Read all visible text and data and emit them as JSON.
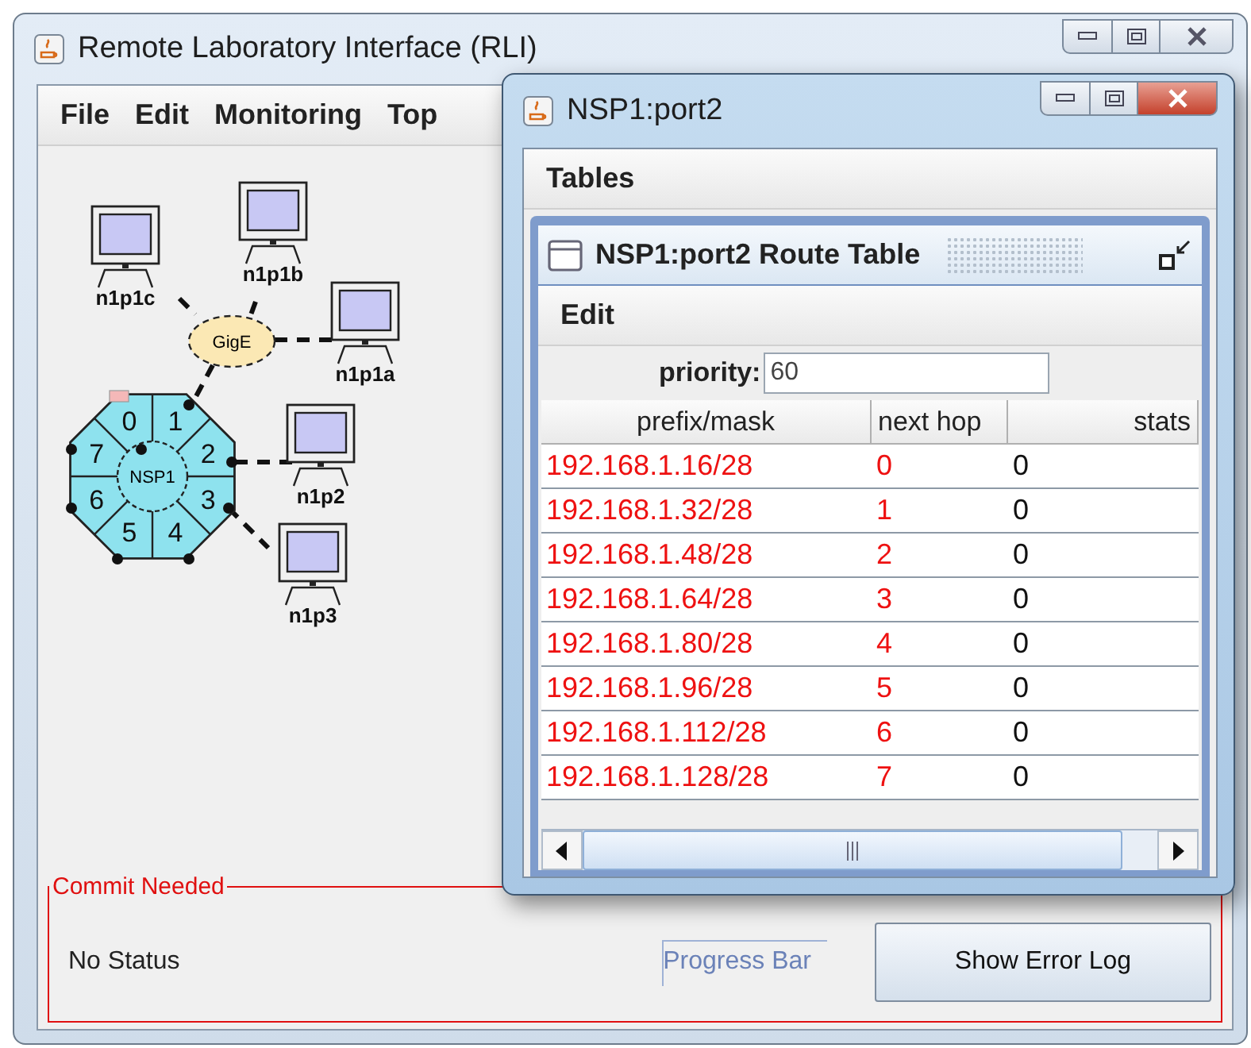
{
  "main_window": {
    "title": "Remote Laboratory Interface (RLI)",
    "menu": [
      "File",
      "Edit",
      "Monitoring",
      "Top"
    ]
  },
  "topology": {
    "hosts": [
      {
        "label": "n1p1c"
      },
      {
        "label": "n1p1b"
      },
      {
        "label": "n1p1a"
      },
      {
        "label": "n1p2"
      },
      {
        "label": "n1p3"
      }
    ],
    "switch": {
      "label": "GigE"
    },
    "router": {
      "label": "NSP1",
      "ports": [
        "0",
        "1",
        "2",
        "3",
        "4",
        "5",
        "6",
        "7"
      ]
    }
  },
  "status_panel": {
    "title": "Commit Needed",
    "status": "No Status",
    "progress_label": "Progress Bar",
    "button": "Show Error Log"
  },
  "port_window": {
    "title": "NSP1:port2",
    "menu": [
      "Tables"
    ],
    "route_table": {
      "title": "NSP1:port2 Route Table",
      "menu": [
        "Edit"
      ],
      "priority_label": "priority:",
      "priority_value": "60",
      "columns": [
        "prefix/mask",
        "next hop",
        "stats"
      ],
      "rows": [
        {
          "prefix": "192.168.1.16/28",
          "next_hop": "0",
          "stats": "0"
        },
        {
          "prefix": "192.168.1.32/28",
          "next_hop": "1",
          "stats": "0"
        },
        {
          "prefix": "192.168.1.48/28",
          "next_hop": "2",
          "stats": "0"
        },
        {
          "prefix": "192.168.1.64/28",
          "next_hop": "3",
          "stats": "0"
        },
        {
          "prefix": "192.168.1.80/28",
          "next_hop": "4",
          "stats": "0"
        },
        {
          "prefix": "192.168.1.96/28",
          "next_hop": "5",
          "stats": "0"
        },
        {
          "prefix": "192.168.1.112/28",
          "next_hop": "6",
          "stats": "0"
        },
        {
          "prefix": "192.168.1.128/28",
          "next_hop": "7",
          "stats": "0"
        }
      ]
    }
  }
}
